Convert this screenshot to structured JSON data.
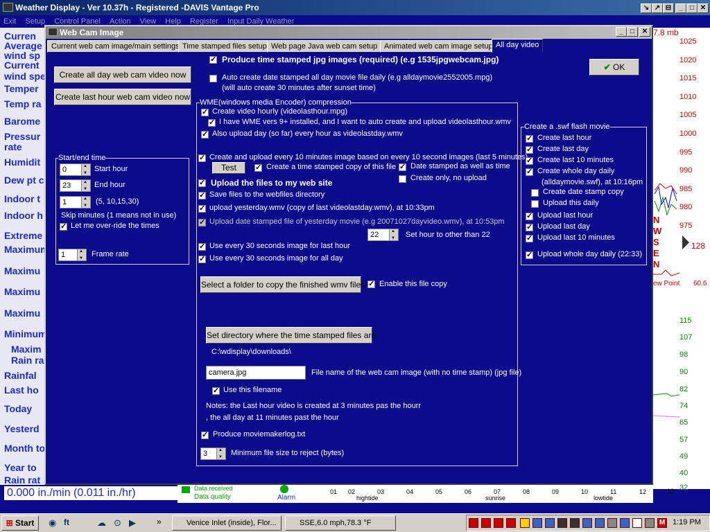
{
  "window": {
    "title": "Weather Display - Ver 10.37h - Registered  -DAVIS Vantage Pro"
  },
  "menu": [
    "Exit",
    "Setup",
    "Control Panel",
    "Action",
    "View",
    "Help",
    "Register",
    "Input Daily Weather"
  ],
  "left_panel": [
    "Curren",
    "Average",
    "wind sp",
    "Current",
    "wind spe",
    "Temper",
    "Temp ra",
    "Barome",
    "Pressur",
    "rate",
    "Humidit",
    "Dew pt c",
    "Indoor t",
    "Indoor h",
    "Extreme",
    "Maximum",
    "Maximu",
    "Maximu",
    "Maximu",
    "Minimum",
    "Maxim",
    "Rain ra",
    "Rainfal",
    "Last ho",
    "Today",
    "Yesterd",
    "Month to",
    "Year to",
    "Rain rat"
  ],
  "bottom_rate": "0.000 in./min (0.011 in./hr)",
  "right_panel": {
    "header": "7.8 mb",
    "ticks1": [
      "1025",
      "1020",
      "1015",
      "1010",
      "1005",
      "1000",
      "995",
      "990",
      "985",
      "980",
      "975"
    ],
    "nesw": [
      "N",
      "W",
      "S",
      "E",
      "N"
    ],
    "val128": "128",
    "dew": "ew Point",
    "dewv": "60.6",
    "ticks2": [
      "115",
      "107",
      "98",
      "90",
      "82",
      "74",
      "65",
      "57",
      "49",
      "40",
      "32"
    ]
  },
  "bottom_strip": {
    "labels": [
      "01",
      "02",
      "03",
      "04",
      "05",
      "06",
      "07",
      "08",
      "09",
      "10",
      "11",
      "12",
      "13"
    ],
    "hightide": "hightide",
    "sunrise": "sunrise",
    "lowtide": "lowtide",
    "alarm": "Alarm",
    "dq": "Data quality",
    "dr": "Data received"
  },
  "dialog": {
    "title": "Web Cam Image",
    "tabs": [
      "Current web cam image/main settings",
      "Time stamped files setup",
      "Web page Java web cam setup",
      "Animated web cam image setup",
      "All day video"
    ],
    "ok": "OK",
    "btn_all_day": "Create all day web cam video now",
    "btn_last_hour": "Create last hour web cam video now",
    "produce_ts": "Produce time stamped jpg images (required) (e.g 1535jpgwebcam.jpg)",
    "auto_create": "Auto create date stamped all day movie file daily (e.g alldaymovie2552005.mpg)",
    "auto_note": "(will auto create 30 minutes after sunset time)",
    "startend": {
      "title": "Start/end time",
      "start_val": "0",
      "start_lbl": "Start hour",
      "end_val": "23",
      "end_lbl": "End hour",
      "skip_val": "1",
      "skip_opts": "(5, 10,15,30)",
      "skip_lbl": "Skip minutes (1 means not in use)",
      "override": "Let me over-ride the times",
      "frame_val": "1",
      "frame_lbl": "Frame rate"
    },
    "wme": {
      "title": "WME(windows media Encoder) compression",
      "hourly": "Create video hourly (videolasthour.mpg)",
      "have_wme": "I have WME vers 9+ installed, and I want to auto create and upload videolasthour.wmv",
      "upload_day": "Also upload day (so far) every hour as videolastday.wmv"
    },
    "every10": "Create and upload every 10 minutes image based on every 10 second images (last 5 minutes)",
    "test": "Test",
    "ts_copy": "Create a time stamped copy of this file",
    "date_stamped": "Date stamped as well as time",
    "create_only": "Create only, no upload",
    "upload_web": "Upload the files to my web site",
    "save_files": "Save files to the webfiles directory",
    "upload_yest": "upload yesterday.wmv (copy of last videolastday.wmv), at 10:33pm",
    "upload_date": "Upload date stamped file of yesterday movie (e.g 20071027dayvideo.wmv), at 10:53pm",
    "hour_val": "22",
    "hour_lbl": "Set hour to other than 22",
    "every30_hour": "Use every 30 seconds image for last hour",
    "every30_day": "Use every 30 seconds image for all day",
    "btn_folder": "Select a folder to copy the finished wmv files to",
    "enable_copy": "Enable this file copy",
    "btn_dir": "Set directory where the time stamped files are",
    "dir_path": "C:\\wdisplay\\downloads\\",
    "camera_val": "camera.jpg",
    "camera_lbl": "File name of the web cam image (with no time stamp) (jpg file)",
    "use_fn": "Use this filename",
    "notes1": "Notes: the Last hour video is created at 3 minutes pas the hourr",
    "notes2": ", the all day at 11 minutes past the hour",
    "moviemaker": "Produce moviemakerlog.txt",
    "minsize_val": "3",
    "minsize_lbl": "Minimum file size to reject (bytes)",
    "swf": {
      "title": "Create a .swf flash movie",
      "last_hour": "Create last hour",
      "last_day": "Create last day",
      "last_10": "Create last 10 minutes",
      "whole_day": "Create whole day daily",
      "whole_note": "(alldaymovie.swf), at 10:16pm",
      "date_copy": "Create date stamp copy",
      "upload_daily": "Upload this daily",
      "u_hour": "Upload last hour",
      "u_day": "Upload last day",
      "u_10": "Upload last 10 minutes",
      "u_whole": "Upload whole day daily (22:33)"
    }
  },
  "taskbar": {
    "start": "Start",
    "task1": "Venice Inlet (inside), Flor...",
    "task2": "SSE,6.0 mph,78.3 °F",
    "clock": "1:19 PM"
  }
}
